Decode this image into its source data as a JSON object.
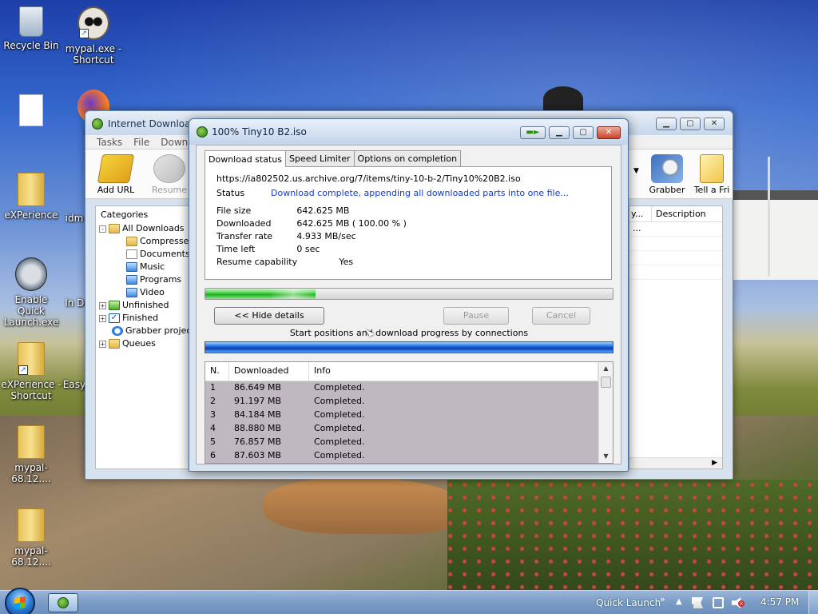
{
  "desktop": {
    "icons": [
      {
        "label": "Recycle Bin"
      },
      {
        "label": "mypal.exe - Shortcut"
      },
      {
        "label": "firef"
      },
      {
        "label": "eXPerience"
      },
      {
        "label": "idm"
      },
      {
        "label": "Enable Quick Launch.exe"
      },
      {
        "label": "In Do"
      },
      {
        "label": "eXPerience - Shortcut"
      },
      {
        "label": "Easy"
      },
      {
        "label": "mypal-68.12...."
      },
      {
        "label": "mypal-68.12...."
      }
    ]
  },
  "idm": {
    "title": "Internet Download",
    "menu": [
      "Tasks",
      "File",
      "Downlo"
    ],
    "toolbar": {
      "add_url": "Add URL",
      "resume": "Resume",
      "grabber": "Grabber",
      "tell_friend": "Tell a Fri"
    },
    "categories": {
      "title": "Categories",
      "items": [
        {
          "label": "All Downloads",
          "exp": "-"
        },
        {
          "label": "Compresse"
        },
        {
          "label": "Documents"
        },
        {
          "label": "Music"
        },
        {
          "label": "Programs"
        },
        {
          "label": "Video"
        },
        {
          "label": "Unfinished",
          "exp": "+"
        },
        {
          "label": "Finished",
          "exp": "+"
        },
        {
          "label": "Grabber projec"
        },
        {
          "label": "Queues",
          "exp": "+"
        }
      ]
    },
    "list": {
      "col_truncated": "y...",
      "col_description": "Description",
      "row_value": "..."
    }
  },
  "dialog": {
    "title": "100% Tiny10 B2.iso",
    "tabs": [
      "Download status",
      "Speed Limiter",
      "Options on completion"
    ],
    "url": "https://ia802502.us.archive.org/7/items/tiny-10-b-2/Tiny10%20B2.iso",
    "status_label": "Status",
    "status_value": "Download complete, appending all downloaded parts into one file...",
    "file_size_label": "File size",
    "file_size_value": "642.625  MB",
    "downloaded_label": "Downloaded",
    "downloaded_value": "642.625  MB  ( 100.00 % )",
    "transfer_rate_label": "Transfer rate",
    "transfer_rate_value": "4.933  MB/sec",
    "time_left_label": "Time left",
    "time_left_value": "0 sec",
    "resume_label": "Resume capability",
    "resume_value": "Yes",
    "progress_fraction": 0.27,
    "hide_details": "<< Hide details",
    "pause": "Pause",
    "cancel": "Cancel",
    "connections_label": "Start positions and download progress by connections",
    "table": {
      "headers": [
        "N.",
        "Downloaded",
        "Info"
      ],
      "rows": [
        {
          "n": "1",
          "downloaded": "86.649  MB",
          "info": "Completed."
        },
        {
          "n": "2",
          "downloaded": "91.197  MB",
          "info": "Completed."
        },
        {
          "n": "3",
          "downloaded": "84.184  MB",
          "info": "Completed."
        },
        {
          "n": "4",
          "downloaded": "88.880  MB",
          "info": "Completed."
        },
        {
          "n": "5",
          "downloaded": "76.857  MB",
          "info": "Completed."
        },
        {
          "n": "6",
          "downloaded": "87.603  MB",
          "info": "Completed."
        }
      ]
    }
  },
  "taskbar": {
    "quick_launch": "Quick Launch",
    "clock": "4:57 PM"
  },
  "colors": {
    "link": "#1440c8",
    "progress_green": "#20a820",
    "connection_blue": "#0a3fb0",
    "table_bg": "#bfb8c1"
  }
}
